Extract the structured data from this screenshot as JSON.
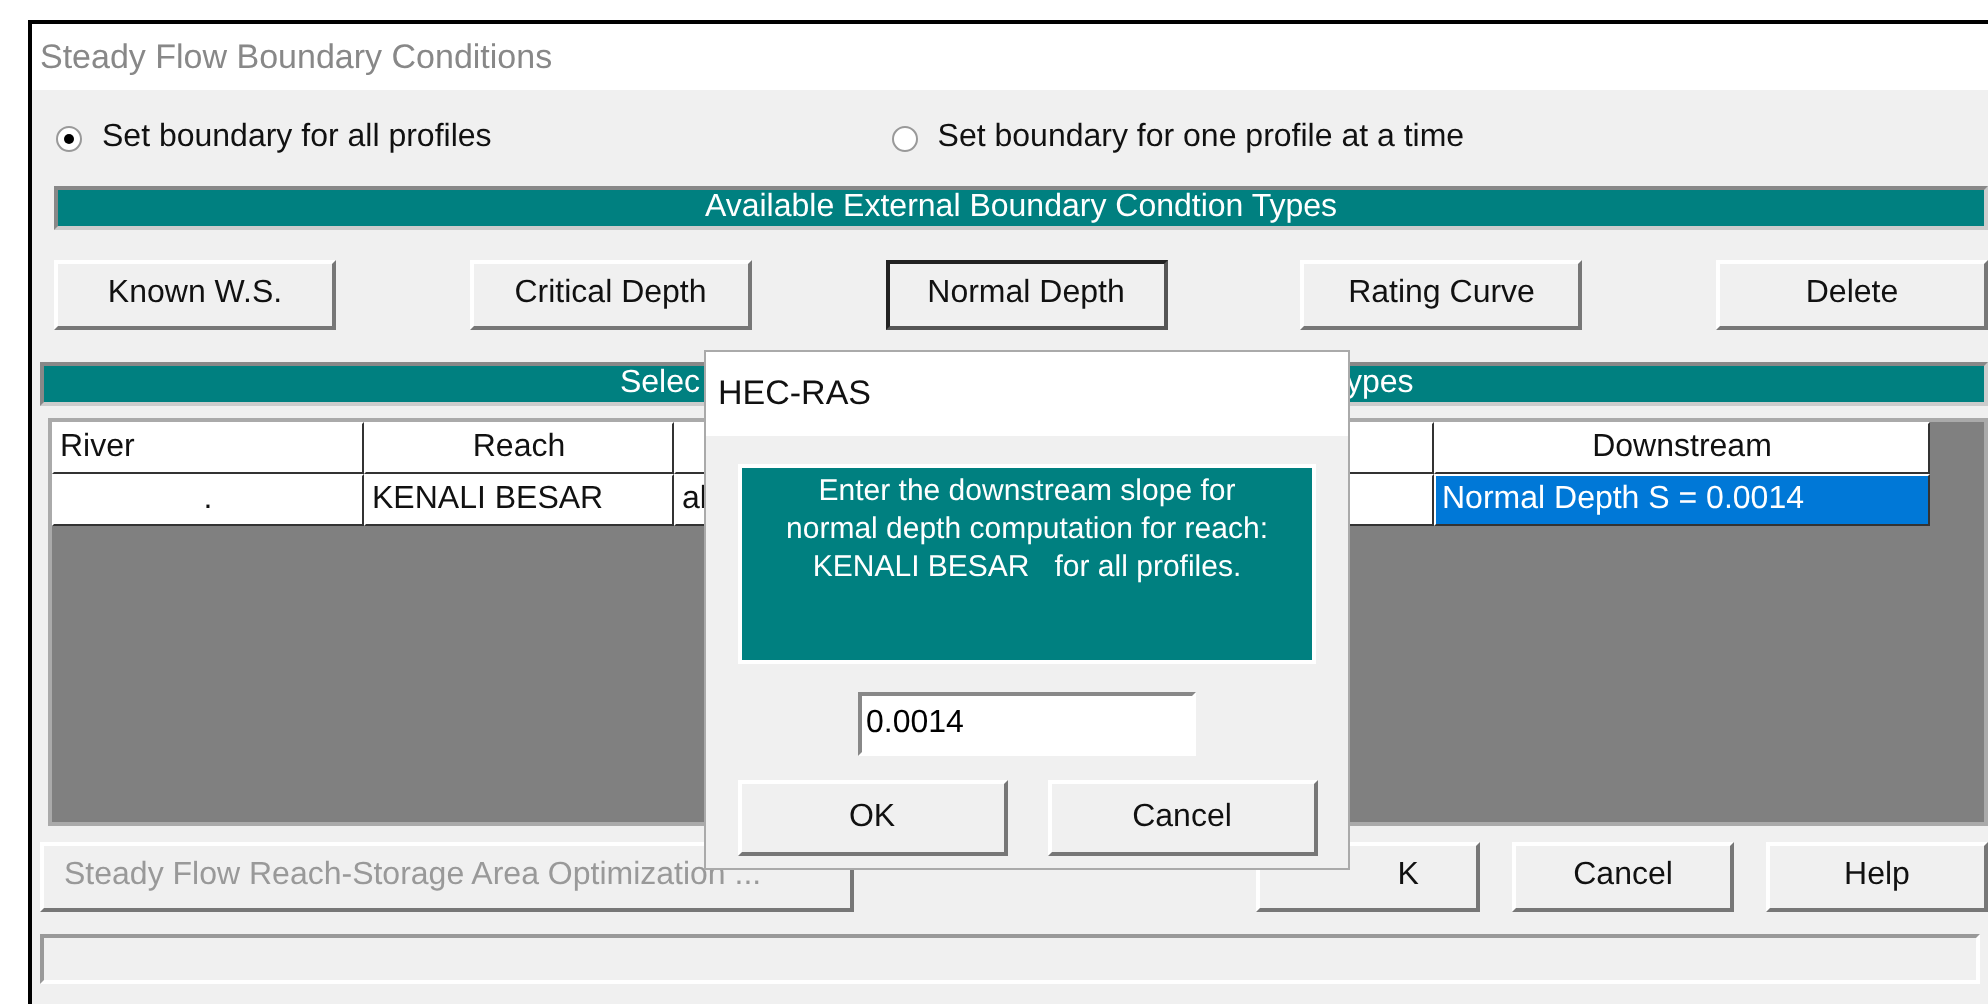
{
  "window": {
    "title": "Steady Flow Boundary Conditions"
  },
  "profile_mode": [
    {
      "label": "Set boundary for all profiles",
      "selected": true
    },
    {
      "label": "Set boundary for one profile at a time",
      "selected": false
    }
  ],
  "available_types": {
    "heading": "Available External Boundary Condtion Types",
    "buttons": [
      {
        "label": "Known W.S.",
        "focused": false
      },
      {
        "label": "Critical Depth",
        "focused": false
      },
      {
        "label": "Normal Depth",
        "focused": true
      },
      {
        "label": "Rating Curve",
        "focused": false
      },
      {
        "label": "Delete",
        "focused": false
      }
    ]
  },
  "selected_types": {
    "heading_left": "Selec",
    "heading_right": "ypes"
  },
  "table": {
    "columns": [
      "River",
      "Reach",
      "",
      "",
      " Downstream"
    ],
    "rows": [
      {
        "cells": [
          {
            "text": ".",
            "selected": false
          },
          {
            "text": "KENALI BESAR",
            "selected": false
          },
          {
            "text": "al",
            "selected": false
          },
          {
            "text": "",
            "selected": false
          },
          {
            "text": "Normal Depth S = 0.0014",
            "selected": true
          }
        ]
      }
    ]
  },
  "optimization_button": {
    "label": "Steady Flow Reach-Storage Area Optimization ...",
    "disabled": true
  },
  "footer_buttons": [
    "K",
    "Cancel",
    "Help"
  ],
  "dialog": {
    "title": "HEC-RAS",
    "message": "Enter the downstream slope for normal depth computation for reach: KENALI BESAR   for all profiles.",
    "value": "0.0014",
    "buttons": [
      "OK",
      "Cancel"
    ]
  }
}
